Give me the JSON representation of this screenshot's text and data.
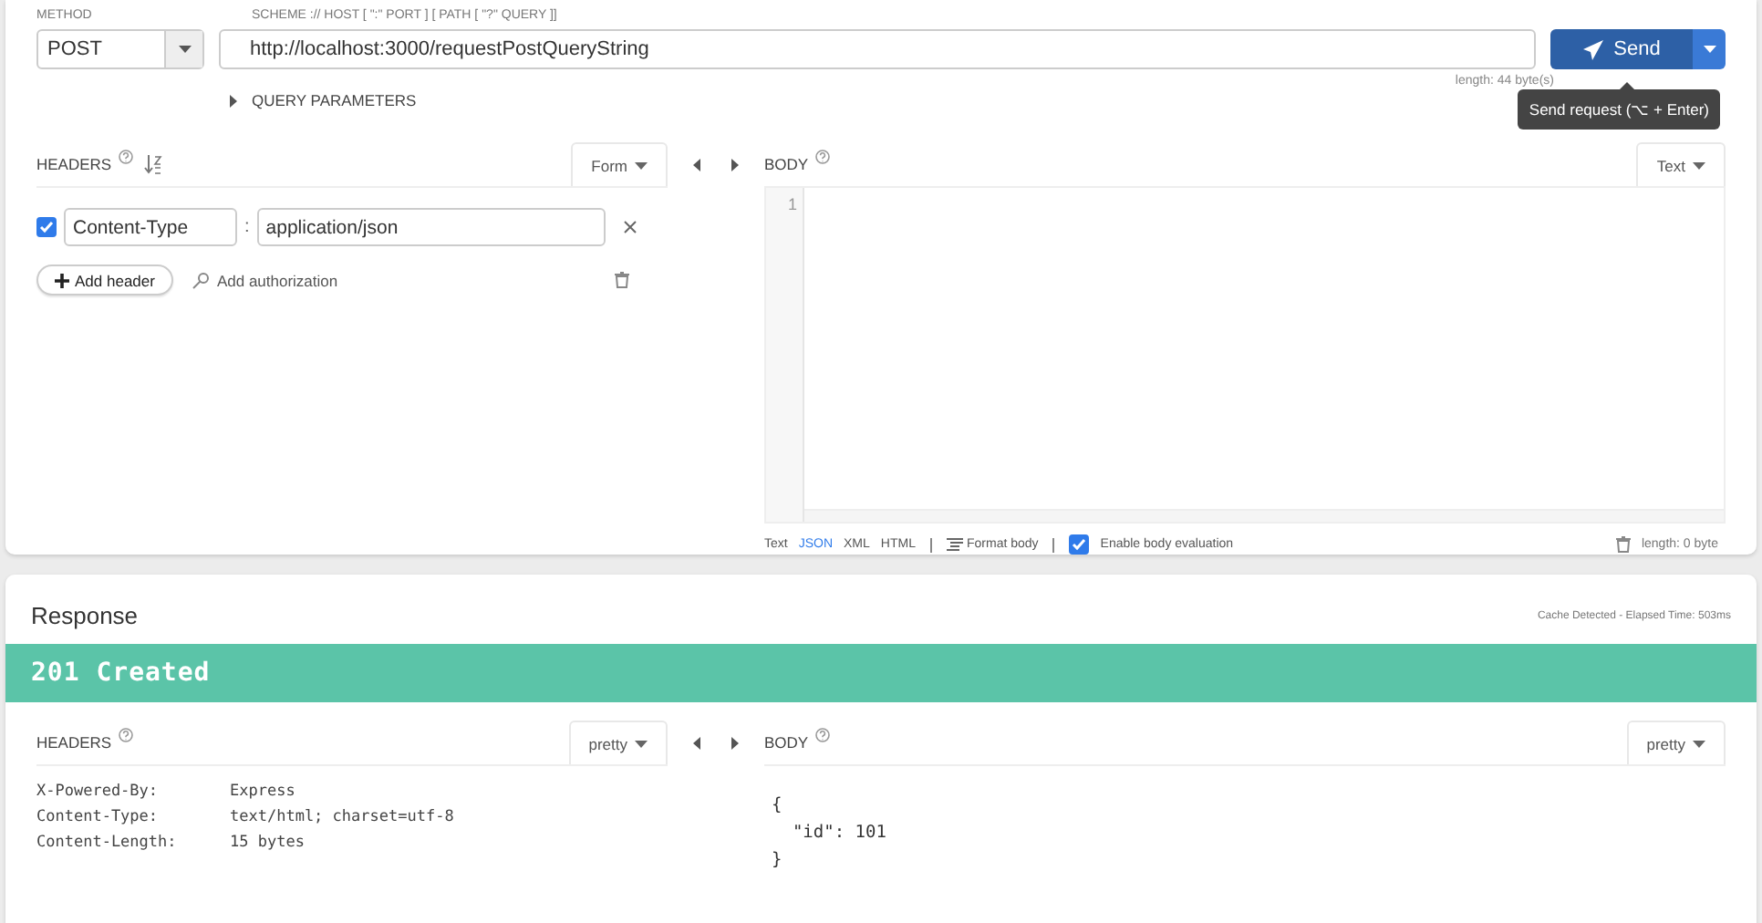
{
  "request": {
    "method_label": "METHOD",
    "method": "POST",
    "url_label": "SCHEME :// HOST [ \":\" PORT ] [ PATH [ \"?\" QUERY ]]",
    "url": "http://localhost:3000/requestPostQueryString",
    "send_label": "Send",
    "tooltip": "Send request (⌥ + Enter)",
    "length": "length: 44 byte(s)",
    "query_parameters": "QUERY PARAMETERS",
    "headers": {
      "title": "HEADERS",
      "format": "Form",
      "rows": [
        {
          "checked": true,
          "name": "Content-Type",
          "separator": ":",
          "value": "application/json"
        }
      ],
      "add_header": "Add header",
      "add_authorization": "Add authorization"
    },
    "body": {
      "title": "BODY",
      "format": "Text",
      "line_numbers": [
        "1"
      ],
      "formats": [
        {
          "label": "Text",
          "selected": false
        },
        {
          "label": "JSON",
          "selected": true
        },
        {
          "label": "XML",
          "selected": false
        },
        {
          "label": "HTML",
          "selected": false
        }
      ],
      "format_body": "Format body",
      "evaluation": {
        "label": "Enable body evaluation",
        "checked": true
      },
      "length": "length: 0 byte"
    }
  },
  "response": {
    "title": "Response",
    "cache_info": "Cache Detected - Elapsed Time: 503ms",
    "status": "201 Created",
    "headers": {
      "title": "HEADERS",
      "format": "pretty",
      "rows": [
        {
          "name": "X-Powered-By:",
          "value": "Express"
        },
        {
          "name": "Content-Type:",
          "value": "text/html; charset=utf-8"
        },
        {
          "name": "Content-Length:",
          "value": "15 bytes"
        }
      ]
    },
    "body": {
      "title": "BODY",
      "format": "pretty",
      "lines": [
        "{",
        "  \"id\": 101",
        "}"
      ]
    }
  }
}
